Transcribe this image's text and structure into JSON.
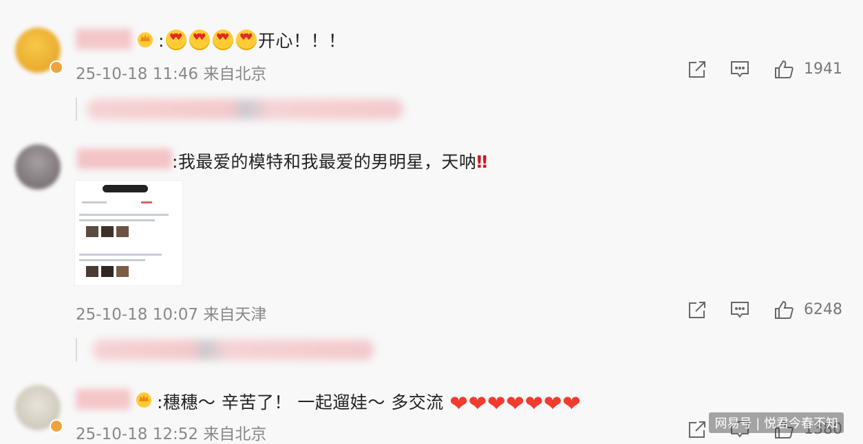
{
  "comments": [
    {
      "text_prefix": ":",
      "text_suffix": "开心！！！",
      "emoji_count": 4,
      "timestamp": "25-10-18 11:46",
      "location": "来自北京",
      "likes": "1941"
    },
    {
      "text": ":我最爱的模特和我最爱的男明星，天呐",
      "exclamation": "‼",
      "timestamp": "25-10-18 10:07",
      "location": "来自天津",
      "likes": "6248"
    },
    {
      "text": ":穗穗～ 辛苦了！ 一起遛娃～ 多交流",
      "hearts": "❤❤❤❤❤❤❤",
      "timestamp": "25-10-18 12:52",
      "location": "来自北京",
      "likes": "1380"
    }
  ],
  "icons": {
    "share": "share-icon",
    "comment": "comment-icon",
    "like": "thumbs-up-icon",
    "crown": "crown-badge-icon"
  },
  "colors": {
    "background": "#f8f8f9",
    "meta_text": "#888888",
    "heart": "#f23b2f",
    "avatar_badge": "#f0a33a"
  },
  "watermark": "网易号 | 悦君今春不知"
}
